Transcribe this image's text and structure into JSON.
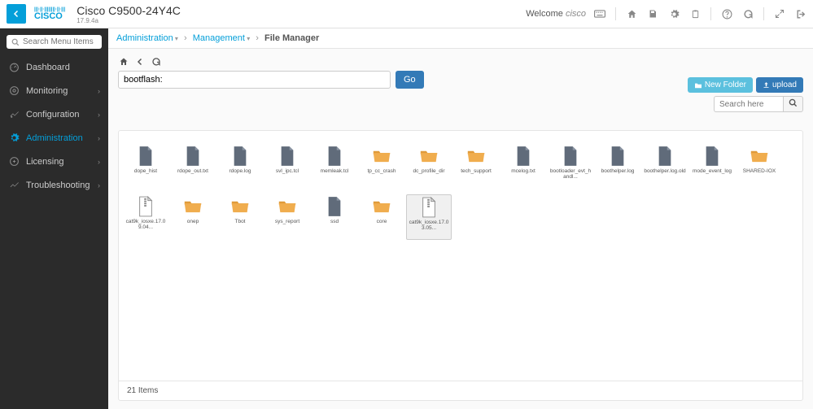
{
  "header": {
    "device_title": "Cisco C9500-24Y4C",
    "device_version": "17.9.4a",
    "welcome_prefix": "Welcome ",
    "welcome_user": "cisco"
  },
  "sidebar": {
    "search_placeholder": "Search Menu Items",
    "items": [
      {
        "label": "Dashboard",
        "active": false
      },
      {
        "label": "Monitoring",
        "active": false
      },
      {
        "label": "Configuration",
        "active": false
      },
      {
        "label": "Administration",
        "active": true
      },
      {
        "label": "Licensing",
        "active": false
      },
      {
        "label": "Troubleshooting",
        "active": false
      }
    ]
  },
  "breadcrumb": {
    "a": "Administration",
    "b": "Management",
    "c": "File Manager"
  },
  "filemanager": {
    "path": "bootflash:",
    "go_label": "Go",
    "new_folder_label": "New Folder",
    "upload_label": "upload",
    "search_placeholder": "Search here",
    "footer": "21 Items",
    "items": [
      {
        "name": "dope_hist",
        "type": "file",
        "selected": false
      },
      {
        "name": "rdope_out.txt",
        "type": "file",
        "selected": false
      },
      {
        "name": "rdope.log",
        "type": "file",
        "selected": false
      },
      {
        "name": "svl_ipc.tcl",
        "type": "file",
        "selected": false
      },
      {
        "name": "memleak.tcl",
        "type": "file",
        "selected": false
      },
      {
        "name": "tp_cc_crash",
        "type": "folder",
        "selected": false
      },
      {
        "name": "dc_profile_dir",
        "type": "folder",
        "selected": false
      },
      {
        "name": "tech_support",
        "type": "folder",
        "selected": false
      },
      {
        "name": "mcelog.txt",
        "type": "file",
        "selected": false
      },
      {
        "name": "bootloader_evt_handl...",
        "type": "file",
        "selected": false
      },
      {
        "name": "boothelper.log",
        "type": "file",
        "selected": false
      },
      {
        "name": "boothelper.log.old",
        "type": "file",
        "selected": false
      },
      {
        "name": "mode_event_log",
        "type": "file",
        "selected": false
      },
      {
        "name": "SHARED-IOX",
        "type": "folder",
        "selected": false
      },
      {
        "name": "cat9k_iosxe.17.09.04...",
        "type": "zip",
        "selected": false
      },
      {
        "name": "onep",
        "type": "folder",
        "selected": false
      },
      {
        "name": "Tbot",
        "type": "folder",
        "selected": false
      },
      {
        "name": "sys_report",
        "type": "folder",
        "selected": false
      },
      {
        "name": "ssd",
        "type": "file",
        "selected": false
      },
      {
        "name": "core",
        "type": "folder",
        "selected": false
      },
      {
        "name": "cat9k_iosxe.17.03.05...",
        "type": "zip",
        "selected": true
      }
    ]
  }
}
